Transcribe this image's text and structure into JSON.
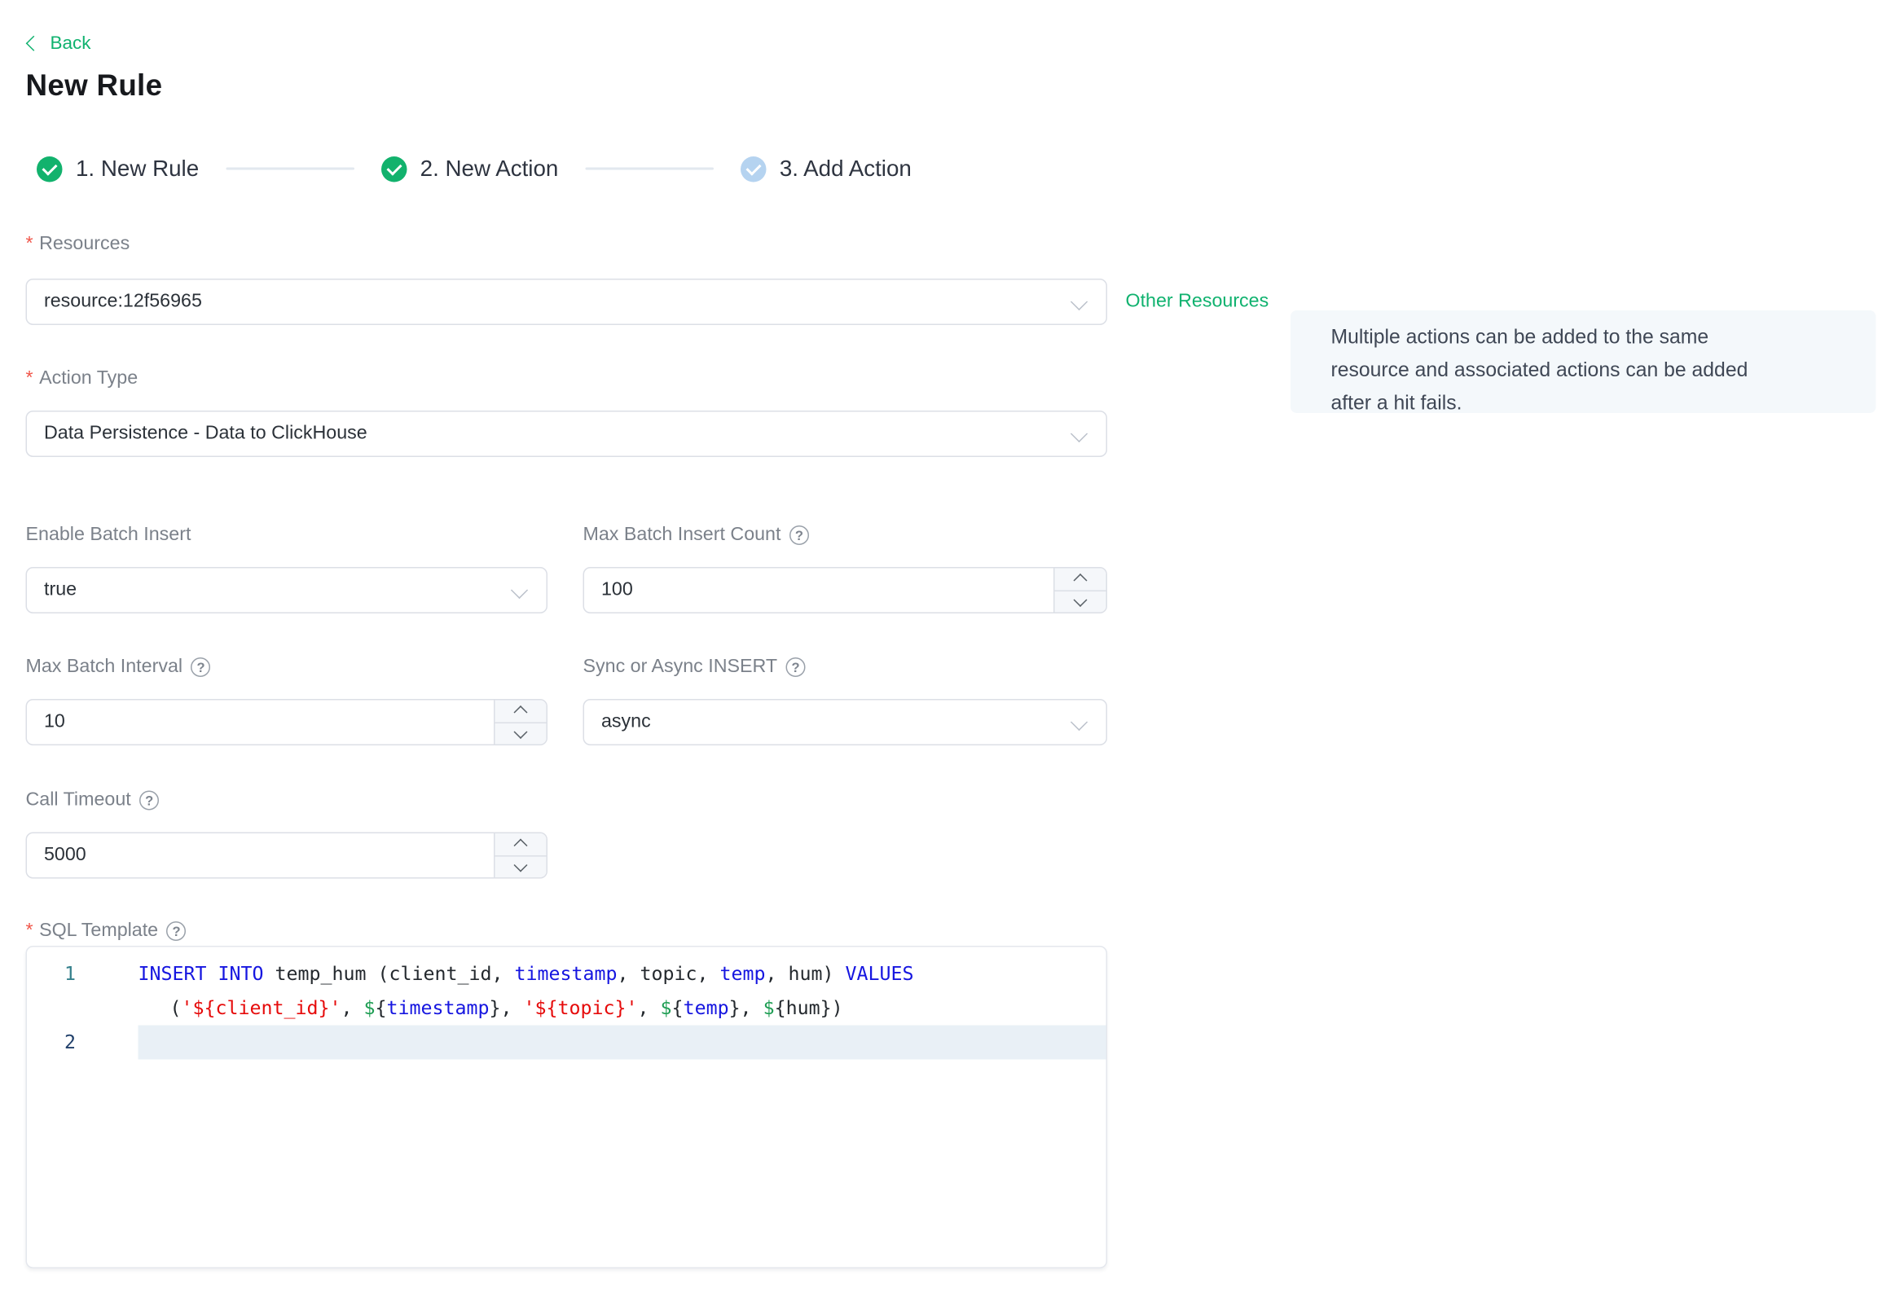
{
  "page": {
    "back_label": "Back",
    "title": "New Rule",
    "required_marker": "*"
  },
  "icons": {
    "help_glyph": "?"
  },
  "colors": {
    "accent_green": "#10b26f",
    "step_done": "#12b26d",
    "step_pending": "#b5d3f0",
    "required_red": "#f0564a",
    "info_box_bg": "#f4f8fb",
    "active_line_bg": "#e9f0f6",
    "code_keyword": "#1616e0",
    "code_string": "#e60b0b",
    "code_dollar": "#1f9e54"
  },
  "steps": [
    {
      "label": "1. New Rule",
      "state": "done"
    },
    {
      "label": "2. New Action",
      "state": "done"
    },
    {
      "label": "3. Add Action",
      "state": "pending"
    }
  ],
  "form": {
    "resources": {
      "label": "Resources",
      "value": "resource:12f56965",
      "side_link": "Other Resources"
    },
    "info_box": {
      "lines": [
        "Multiple actions can be added to the same",
        "resource and associated actions can be added",
        "after a hit fails."
      ]
    },
    "action_type": {
      "label": "Action Type",
      "value": "Data Persistence - Data to ClickHouse"
    },
    "enable_batch": {
      "label": "Enable Batch Insert",
      "value": "true"
    },
    "max_batch_count": {
      "label": "Max Batch Insert Count",
      "value": "100"
    },
    "max_batch_interval": {
      "label": "Max Batch Interval",
      "value": "10"
    },
    "sync_async": {
      "label": "Sync or Async INSERT",
      "value": "async"
    },
    "call_timeout": {
      "label": "Call Timeout",
      "value": "5000"
    },
    "sql_template": {
      "label": "SQL Template"
    }
  },
  "sql_editor": {
    "rows": [
      {
        "number": "1",
        "num_class": "teal",
        "active": false,
        "indent": false,
        "tokens": [
          [
            "kw",
            "INSERT"
          ],
          [
            "pl",
            " "
          ],
          [
            "kw",
            "INTO"
          ],
          [
            "pl",
            " temp_hum (client_id, "
          ],
          [
            "kw",
            "timestamp"
          ],
          [
            "pl",
            ", topic, "
          ],
          [
            "kw",
            "temp"
          ],
          [
            "pl",
            ", hum) "
          ],
          [
            "kw",
            "VALUES"
          ]
        ]
      },
      {
        "number": "",
        "num_class": "",
        "active": false,
        "indent": true,
        "tokens": [
          [
            "pl",
            "("
          ],
          [
            "str",
            "'${client_id}'"
          ],
          [
            "pl",
            ", "
          ],
          [
            "dollar",
            "$"
          ],
          [
            "pl",
            "{"
          ],
          [
            "kw",
            "timestamp"
          ],
          [
            "pl",
            "}, "
          ],
          [
            "str",
            "'${topic}'"
          ],
          [
            "pl",
            ", "
          ],
          [
            "dollar",
            "$"
          ],
          [
            "pl",
            "{"
          ],
          [
            "kw",
            "temp"
          ],
          [
            "pl",
            "}, "
          ],
          [
            "dollar",
            "$"
          ],
          [
            "pl",
            "{hum})"
          ]
        ]
      },
      {
        "number": "2",
        "num_class": "navy",
        "active": true,
        "indent": false,
        "tokens": []
      }
    ]
  }
}
